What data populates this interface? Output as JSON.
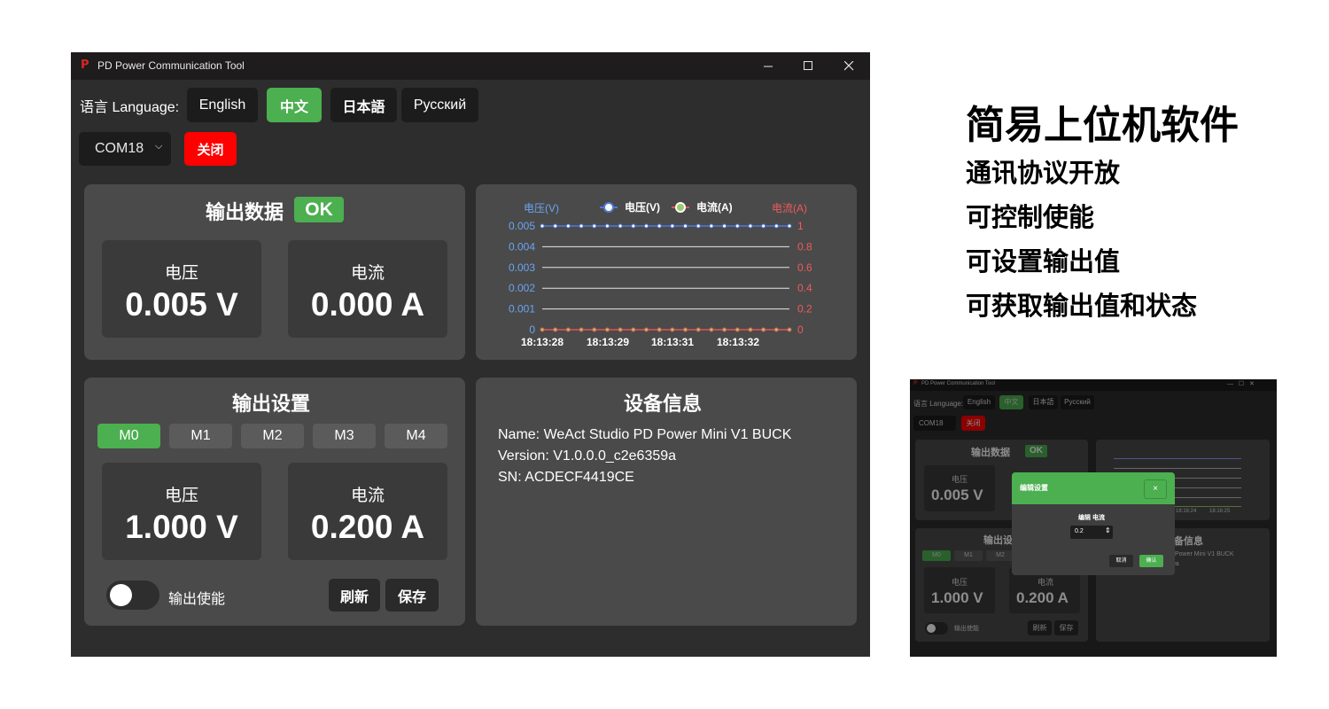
{
  "window": {
    "app_icon": "P",
    "title": "PD Power Communication Tool",
    "controls": {
      "minimize": "—",
      "maximize": "☐",
      "close": "✕"
    }
  },
  "language": {
    "label": "语言 Language:",
    "options": [
      "English",
      "中文",
      "日本語",
      "Русский"
    ],
    "selected": "中文"
  },
  "port": {
    "value": "COM18",
    "close_label": "关闭"
  },
  "output": {
    "title": "输出数据",
    "status": "OK",
    "voltage_label": "电压",
    "voltage_value": "0.005 V",
    "current_label": "电流",
    "current_value": "0.000 A"
  },
  "chart_data": {
    "type": "line",
    "left_axis_label": "电压(V)",
    "right_axis_label": "电流(A)",
    "legend": [
      "电压(V)",
      "电流(A)"
    ],
    "left_ticks": [
      "0.005",
      "0.004",
      "0.003",
      "0.002",
      "0.001",
      "0"
    ],
    "right_ticks": [
      "1",
      "0.8",
      "0.6",
      "0.4",
      "0.2",
      "0"
    ],
    "x_labels": [
      "18:13:28",
      "18:13:29",
      "18:13:31",
      "18:13:32"
    ],
    "ylim_left": [
      0,
      0.005
    ],
    "ylim_right": [
      0,
      1
    ],
    "series": [
      {
        "name": "电压(V)",
        "color": "#4e7bd9",
        "values": [
          0.005,
          0.005,
          0.005,
          0.005,
          0.005,
          0.005,
          0.005,
          0.005,
          0.005,
          0.005,
          0.005,
          0.005,
          0.005,
          0.005,
          0.005,
          0.005,
          0.005,
          0.005,
          0.005,
          0.005
        ]
      },
      {
        "name": "电流(A)",
        "color": "#e05555",
        "values": [
          0,
          0,
          0,
          0,
          0,
          0,
          0,
          0,
          0,
          0,
          0,
          0,
          0,
          0,
          0,
          0,
          0,
          0,
          0,
          0
        ]
      }
    ],
    "grid": true,
    "legend_position": "top-center"
  },
  "settings": {
    "title": "输出设置",
    "modes": [
      "M0",
      "M1",
      "M2",
      "M3",
      "M4"
    ],
    "active_mode": "M0",
    "voltage_label": "电压",
    "voltage_value": "1.000 V",
    "current_label": "电流",
    "current_value": "0.200 A",
    "enable_label": "输出使能",
    "enable_on": false,
    "refresh_label": "刷新",
    "save_label": "保存"
  },
  "device": {
    "title": "设备信息",
    "name": "Name: WeAct Studio PD Power Mini V1 BUCK",
    "version": "Version: V1.0.0.0_c2e6359a",
    "sn": "SN: ACDECF4419CE"
  },
  "features": {
    "title": "简易上位机软件",
    "items": [
      "通讯协议开放",
      "可控制使能",
      "可设置输出值",
      "可获取输出值和状态"
    ]
  },
  "thumbnail": {
    "window_title": "PD Power Communication Tool",
    "lang_label": "语言 Language:",
    "langs": [
      "English",
      "中文",
      "日本語",
      "Русский"
    ],
    "port": "COM18",
    "close": "关闭",
    "output_title": "输出数据",
    "status": "OK",
    "voltage_label": "电压",
    "voltage_value": "0.005 V",
    "settings_title": "输出设",
    "modes": [
      "M0",
      "M1",
      "M2"
    ],
    "set_voltage_label": "电压",
    "set_voltage_value": "1.000 V",
    "set_current_label": "电流",
    "set_current_value": "0.200 A",
    "enable_label": "输出使能",
    "refresh": "刷新",
    "save": "保存",
    "info_title": "备信息",
    "info_name": "D Power Mini V1 BUCK",
    "info_ver": "59a",
    "chart_x": [
      "18:16:24",
      "18:16:25"
    ],
    "dialog": {
      "title": "编辑设置",
      "close": "×",
      "field_label": "编辑 电流",
      "field_value": "0.2",
      "cancel": "取消",
      "confirm": "确认"
    }
  }
}
